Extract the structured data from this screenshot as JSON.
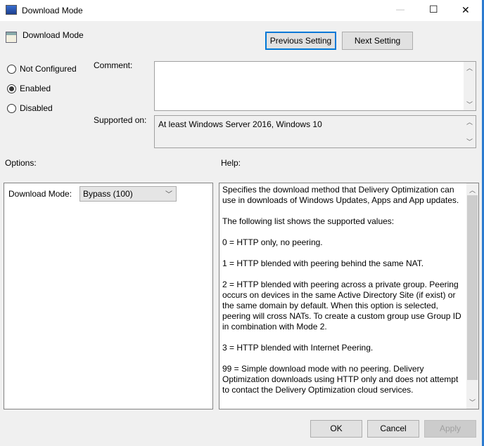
{
  "window": {
    "title": "Download Mode",
    "minimize": "—",
    "maximize": "☐",
    "close": "✕"
  },
  "header": {
    "setting_name": "Download Mode",
    "previous_label": "Previous Setting",
    "next_label": "Next Setting"
  },
  "state": {
    "options": [
      {
        "label": "Not Configured",
        "checked": false
      },
      {
        "label": "Enabled",
        "checked": true
      },
      {
        "label": "Disabled",
        "checked": false
      }
    ]
  },
  "comment": {
    "label": "Comment:",
    "value": ""
  },
  "supported": {
    "label": "Supported on:",
    "value": "At least Windows Server 2016, Windows 10"
  },
  "options_panel": {
    "label": "Options:",
    "download_mode_label": "Download Mode:",
    "download_mode_value": "Bypass (100)"
  },
  "help": {
    "label": "Help:",
    "lines": [
      "Specifies the download method that Delivery Optimization can",
      "use in downloads of Windows Updates, Apps and App updates.",
      "",
      "The following list shows the supported values:",
      "",
      "0 = HTTP only, no peering.",
      "",
      "1 = HTTP blended with peering behind the same NAT.",
      "",
      "2 = HTTP blended with peering across a private group. Peering",
      "occurs on devices in the same Active Directory Site (if exist) or",
      "the same domain by default. When this option is selected,",
      "peering will cross NATs. To create a custom group use Group ID",
      "in combination with Mode 2.",
      "",
      "3 = HTTP blended with Internet Peering.",
      "",
      "99 = Simple download mode with no peering. Delivery",
      "Optimization downloads using HTTP only and does not attempt",
      "to contact the Delivery Optimization cloud services."
    ]
  },
  "footer": {
    "ok": "OK",
    "cancel": "Cancel",
    "apply": "Apply"
  }
}
